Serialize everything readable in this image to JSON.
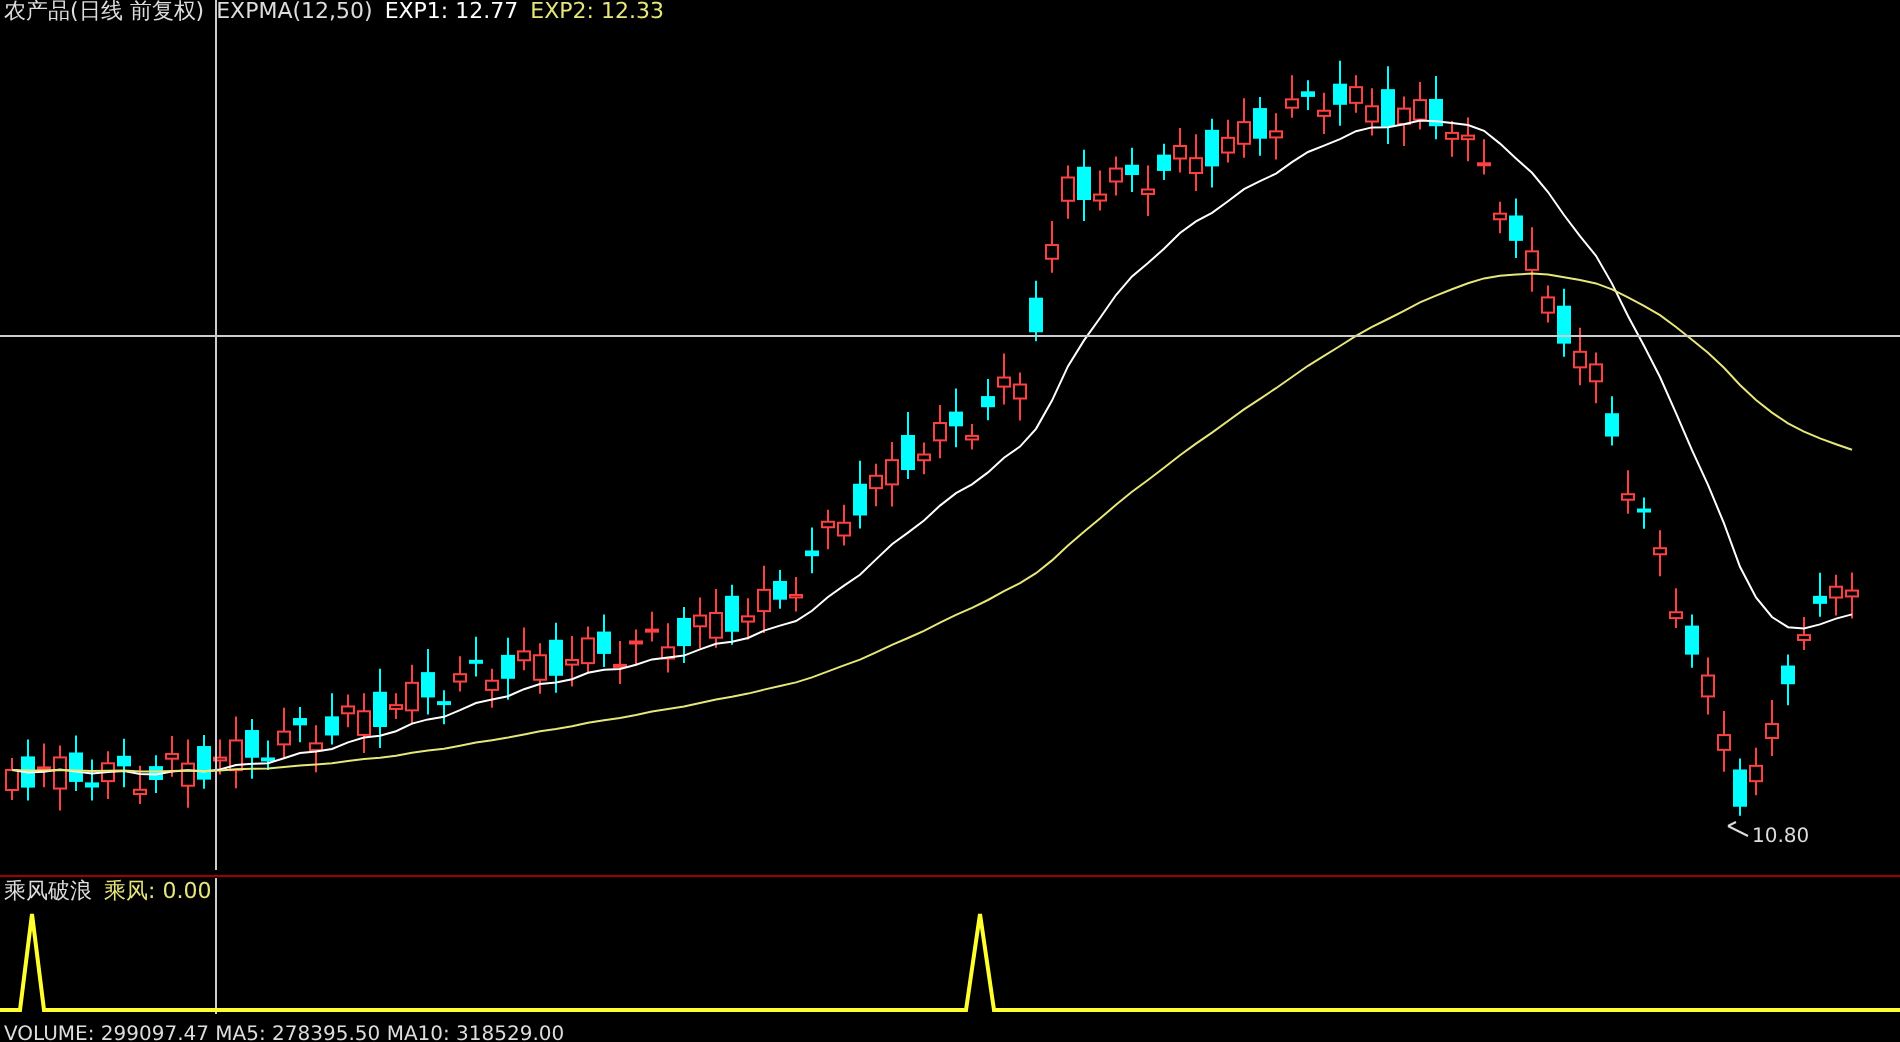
{
  "main_chart": {
    "title": "农产品(日线 前复权)",
    "indicator": "EXPMA(12,50)",
    "readings": [
      {
        "label": "EXP1: 12.77",
        "color": "#ffffff"
      },
      {
        "label": "EXP2: 12.33",
        "color": "#e6e67a"
      }
    ],
    "low_label": "10.80"
  },
  "sub_chart": {
    "title": "乘风破浪",
    "reading": "乘风: 0.00"
  },
  "volume_line": "VOLUME: 299097.47 MA5: 278395.50 MA10: 318529.00"
}
